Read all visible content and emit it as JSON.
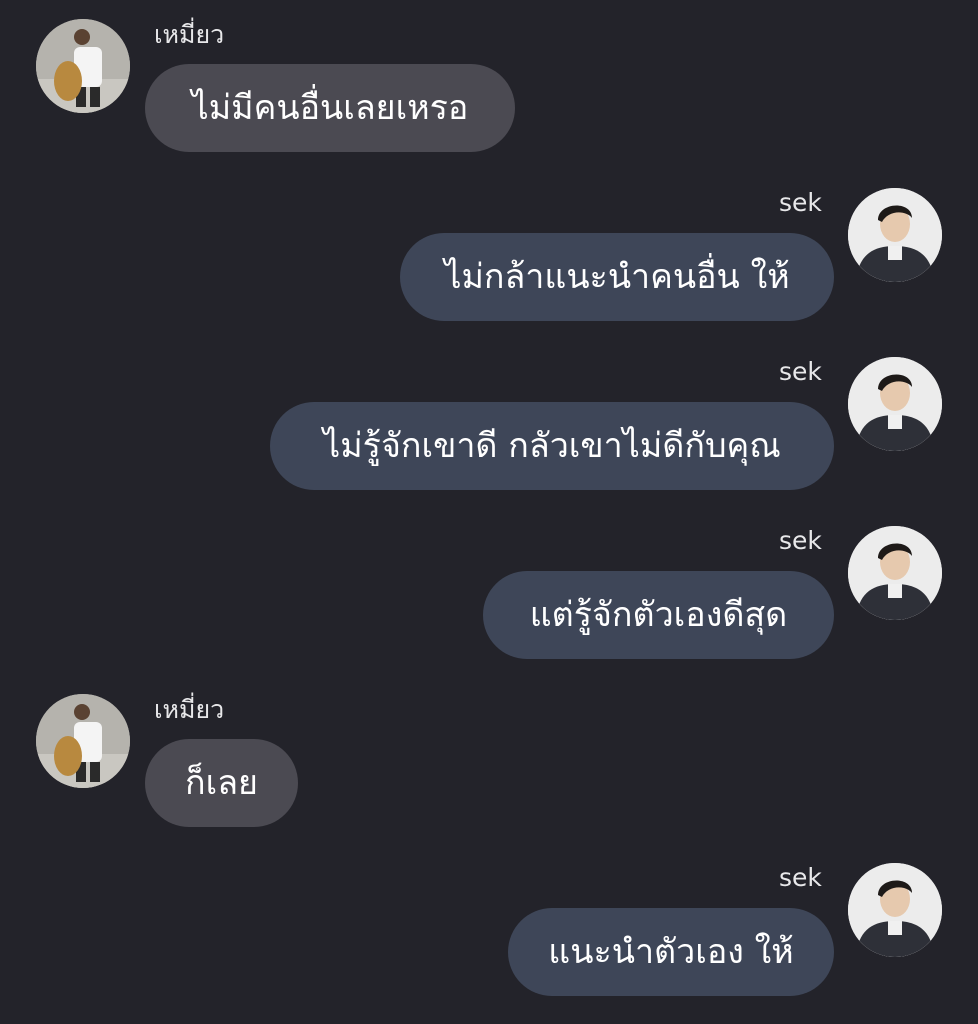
{
  "conversation": {
    "messages": [
      {
        "sender": "เหมี่ยว",
        "side": "left",
        "text": "ไม่มีคนอื่นเลยเหรอ",
        "avatar_icon": "user-avatar-icon"
      },
      {
        "sender": "sek",
        "side": "right",
        "text": "ไม่กล้าแนะนำคนอื่น ให้",
        "avatar_icon": "user-avatar-icon"
      },
      {
        "sender": "sek",
        "side": "right",
        "text": "ไม่รู้จักเขาดี กลัวเขาไม่ดีกับคุณ",
        "avatar_icon": "user-avatar-icon"
      },
      {
        "sender": "sek",
        "side": "right",
        "text": "แต่รู้จักตัวเองดีสุด",
        "avatar_icon": "user-avatar-icon"
      },
      {
        "sender": "เหมี่ยว",
        "side": "left",
        "text": "ก็เลย",
        "avatar_icon": "user-avatar-icon"
      },
      {
        "sender": "sek",
        "side": "right",
        "text": "แนะนำตัวเอง ให้",
        "avatar_icon": "user-avatar-icon"
      }
    ]
  },
  "colors": {
    "background": "#23232a",
    "incoming_bubble": "#4b4a52",
    "outgoing_bubble": "#3e4658",
    "text": "#ffffff"
  }
}
